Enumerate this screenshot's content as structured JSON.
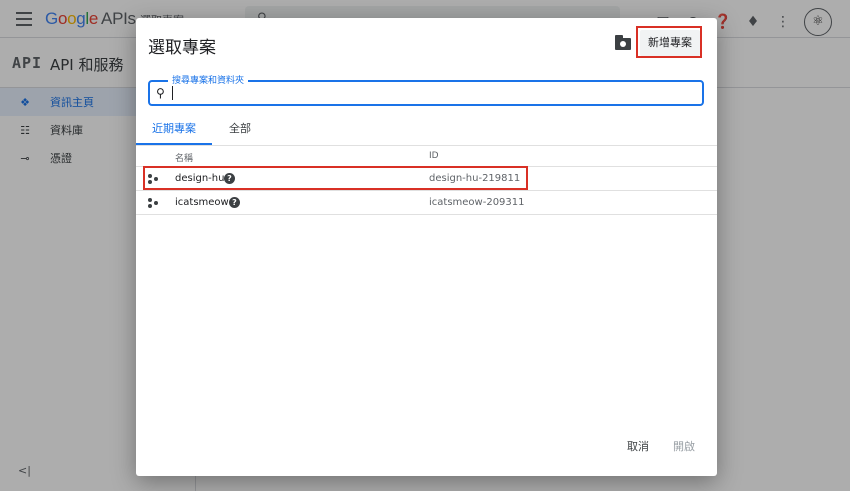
{
  "topbar": {
    "logo_letters": [
      "G",
      "o",
      "o",
      "g",
      "l",
      "e"
    ],
    "logo_suffix": "APIs",
    "project_chip": "選取專案"
  },
  "api_header": {
    "badge": "API",
    "title": "API 和服務"
  },
  "sidebar": {
    "items": [
      {
        "label": "資訊主頁",
        "icon": "dashboard-icon",
        "active": true
      },
      {
        "label": "資料庫",
        "icon": "library-icon",
        "active": false
      },
      {
        "label": "憑證",
        "icon": "key-icon",
        "active": false
      }
    ],
    "collapse_label": "<|"
  },
  "dialog": {
    "title": "選取專案",
    "new_project_label": "新增專案",
    "search_placeholder": "搜尋專案和資料夾",
    "tabs": [
      {
        "label": "近期專案",
        "active": true
      },
      {
        "label": "全部",
        "active": false
      }
    ],
    "table": {
      "columns": [
        "名稱",
        "ID"
      ],
      "rows": [
        {
          "name": "design-hu",
          "id": "design-hu-219811"
        },
        {
          "name": "icatsmeow",
          "id": "icatsmeow-209311"
        }
      ]
    },
    "cancel_label": "取消",
    "open_label": "開啟"
  },
  "colors": {
    "accent": "#1a73e8",
    "highlight": "#d93025"
  }
}
